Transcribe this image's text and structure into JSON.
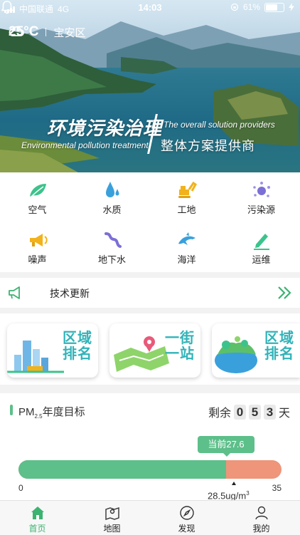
{
  "status_bar": {
    "carrier": "中国联通",
    "network": "4G",
    "time": "14:03",
    "battery": "61%"
  },
  "header": {
    "temperature": "25°C",
    "district": "宝安区"
  },
  "banner": {
    "title_cn": "环境污染治理",
    "title_en": "Environmental pollution treatment",
    "subtitle_en": "The overall solution providers",
    "subtitle_cn": "整体方案提供商"
  },
  "categories": [
    {
      "label": "空气",
      "icon": "leaf-icon"
    },
    {
      "label": "水质",
      "icon": "water-drop-icon"
    },
    {
      "label": "工地",
      "icon": "excavator-icon"
    },
    {
      "label": "污染源",
      "icon": "pollution-source-icon"
    },
    {
      "label": "噪声",
      "icon": "megaphone-icon"
    },
    {
      "label": "地下水",
      "icon": "groundwater-icon"
    },
    {
      "label": "海洋",
      "icon": "dolphin-icon"
    },
    {
      "label": "运维",
      "icon": "pencil-icon"
    }
  ],
  "tech_update": {
    "label": "技术更新"
  },
  "cards": [
    {
      "text_line1": "区域",
      "text_line2": "排名"
    },
    {
      "text_line1": "一街",
      "text_line2": "一站"
    },
    {
      "text_line1": "区域",
      "text_line2": "排名"
    }
  ],
  "pm": {
    "title_prefix": "PM",
    "title_sub": "2.5",
    "title_suffix": "年度目标",
    "remain_label": "剩余",
    "remain_digits": [
      "0",
      "5",
      "3"
    ],
    "remain_unit": "天",
    "current_label": "当前27.6",
    "current_value": 27.6,
    "scale_min": "0",
    "scale_max": "35",
    "min_value": 0,
    "max_value": 35,
    "target_label": "28.5ug/m",
    "target_sup": "3",
    "color_good": "#5dbf8a",
    "color_bad": "#ee957a"
  },
  "tabbar": [
    {
      "label": "首页",
      "icon": "home-icon",
      "active": true
    },
    {
      "label": "地图",
      "icon": "map-icon",
      "active": false
    },
    {
      "label": "发现",
      "icon": "compass-icon",
      "active": false
    },
    {
      "label": "我的",
      "icon": "profile-icon",
      "active": false
    }
  ],
  "colors": {
    "accent": "#3cb371",
    "teal": "#31b3b8"
  }
}
